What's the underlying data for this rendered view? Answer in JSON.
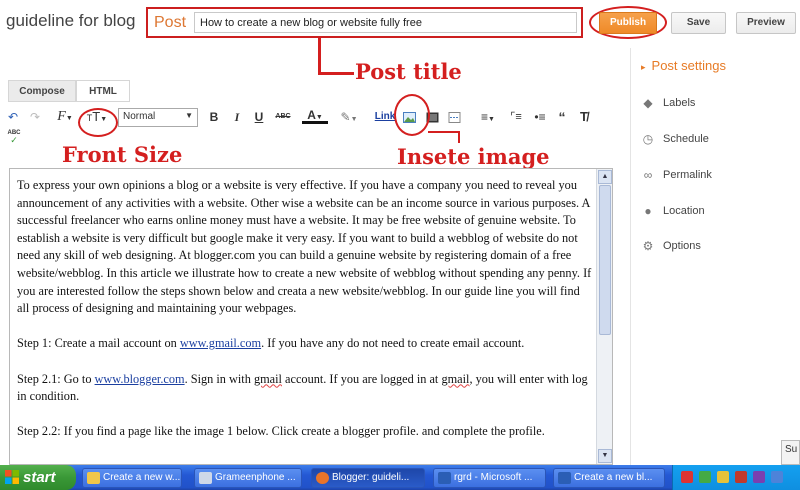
{
  "header": {
    "blog_name": "guideline for blog",
    "post_label": "Post",
    "post_title_value": "How to create a new blog or website fully free",
    "publish": "Publish",
    "save": "Save",
    "preview": "Preview"
  },
  "annotations": {
    "post_title": "Post title",
    "font_size": "Front Size",
    "insert_image": "Insete image"
  },
  "tabs": {
    "compose": "Compose",
    "html": "HTML"
  },
  "toolbar": {
    "format_value": "Normal",
    "bold": "B",
    "italic": "I",
    "underline": "U",
    "strikethrough": "ABC",
    "font_family": "F",
    "font_size_glyph": "T",
    "text_color": "A",
    "link": "Link",
    "spellcheck": "ABC"
  },
  "settings": {
    "title": "Post settings",
    "items": [
      "Labels",
      "Schedule",
      "Permalink",
      "Location",
      "Options"
    ]
  },
  "editor": {
    "paragraphs": [
      "To express your own opinions a blog or a website is very effective. If you have a company you need to reveal you announcement of any activities with a website. Other wise a website can be an income source in various purposes. A successful freelancer who earns online money must have a website. It may be free website of genuine website. To establish a website is very difficult but google make it very easy. If you want to build a webblog of website do not need any skill of web designing. At blogger.com you can build a genuine website by registering domain of a free website/webblog. In this article we illustrate how to create a new website of webblog without spending any penny. If you are interested follow the steps shown below and creata a new website/webblog. In our guide line you will find all process of designing and maintaining your webpages.",
      "Step 1: Create a mail account on www.gmail.com. If you have any do not need to create email account.",
      "Step 2.1: Go to www.blogger.com. Sign in with gmail account. If you are logged in at gmail, you will enter with log in condition.",
      "Step 2.2: If you find a page like the image 1 below. Click create a blogger profile. and complete the profile."
    ],
    "links": [
      "www.gmail.com",
      "www.blogger.com"
    ]
  },
  "corner_popup": "Su",
  "taskbar": {
    "start": "start",
    "tasks": [
      "Create a new w...",
      "Grameenphone ...",
      "Blogger: guideli...",
      "rgrd - Microsoft ...",
      "Create a new bl..."
    ],
    "active_task_index": 2
  },
  "colors": {
    "accent_orange": "#e77b26",
    "annotation_red": "#d41f1f",
    "link_blue": "#1b3fa0",
    "taskbar_blue": "#2458d4"
  }
}
